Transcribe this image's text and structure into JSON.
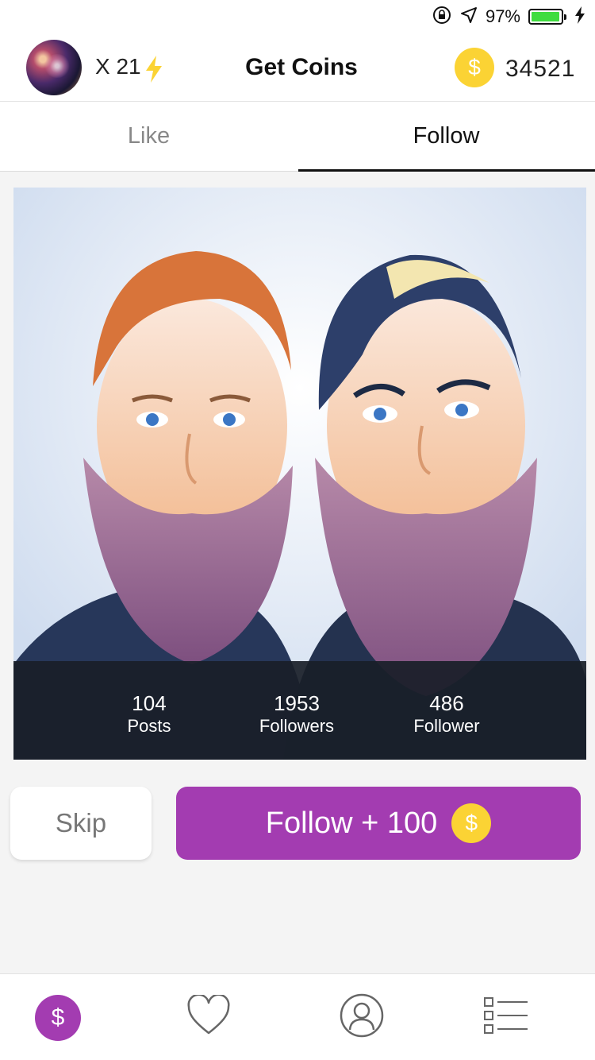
{
  "status_bar": {
    "battery_percent": "97%",
    "battery_level": 0.97,
    "icons": [
      "rotation-lock-icon",
      "location-arrow-icon",
      "battery-icon",
      "charging-bolt-icon"
    ]
  },
  "header": {
    "multiplier": "X 21",
    "title": "Get Coins",
    "coin_symbol": "$",
    "coin_count": "34521"
  },
  "tabs": [
    {
      "label": "Like",
      "active": false
    },
    {
      "label": "Follow",
      "active": true
    }
  ],
  "profile_card": {
    "stats": [
      {
        "value": "104",
        "label": "Posts"
      },
      {
        "value": "1953",
        "label": "Followers"
      },
      {
        "value": "486",
        "label": "Follower"
      }
    ]
  },
  "actions": {
    "skip_label": "Skip",
    "follow_label": "Follow + 100",
    "coin_symbol": "$"
  },
  "bottom_nav": {
    "coin_symbol": "$",
    "items": [
      "coins-tab-icon",
      "heart-icon",
      "profile-icon",
      "list-icon"
    ]
  },
  "colors": {
    "accent_purple": "#a33cb1",
    "coin_yellow": "#fbd334",
    "battery_green": "#3fdc3f"
  }
}
